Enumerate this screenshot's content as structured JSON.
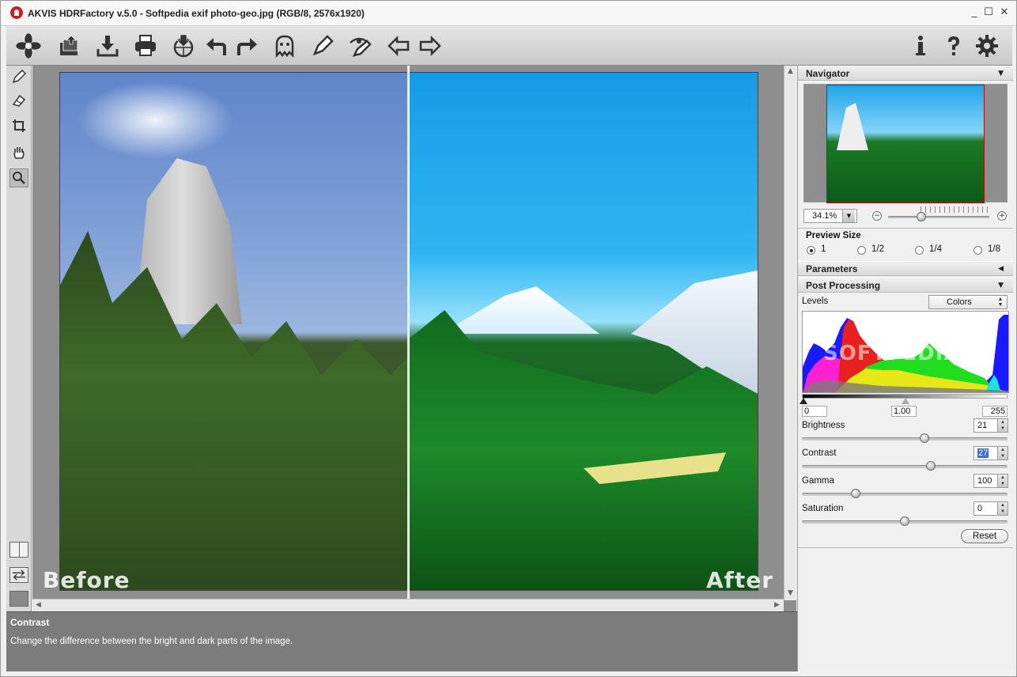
{
  "window": {
    "title": "AKVIS HDRFactory v.5.0 - Softpedia exif photo-geo.jpg (RGB/8, 2576x1920)",
    "minimize": "_",
    "maximize": "☐",
    "close": "✕"
  },
  "toolbar": {
    "icons": [
      "flower-logo",
      "open-batch",
      "save",
      "print",
      "upload",
      "undo",
      "redo",
      "ghost-removal",
      "brush-pen",
      "eye-pen",
      "back-arrow",
      "forward-arrow",
      "info",
      "help",
      "settings"
    ]
  },
  "canvas": {
    "before_label": "Before",
    "after_label": "After"
  },
  "info": {
    "title": "Contrast",
    "text": "Change the difference between the bright and dark parts of the image."
  },
  "navigator": {
    "title": "Navigator",
    "zoom": "34.1%"
  },
  "preview_size": {
    "title": "Preview Size",
    "options": [
      "1",
      "1/2",
      "1/4",
      "1/8"
    ],
    "selected": "1"
  },
  "parameters": {
    "title": "Parameters"
  },
  "post_processing": {
    "title": "Post Processing",
    "levels_label": "Levels",
    "channel": "Colors",
    "levels_min": "0",
    "levels_gamma": "1.00",
    "levels_max": "255",
    "watermark": "SOFTPEDIA",
    "sliders": [
      {
        "label": "Brightness",
        "value": "21"
      },
      {
        "label": "Contrast",
        "value": "27"
      },
      {
        "label": "Gamma",
        "value": "100"
      },
      {
        "label": "Saturation",
        "value": "0"
      }
    ],
    "reset_label": "Reset"
  },
  "colors": {
    "toolbar_bg": "#c9c9c9",
    "info_bg": "#7c7c7c",
    "canvas_bg": "#8e8e8e"
  }
}
